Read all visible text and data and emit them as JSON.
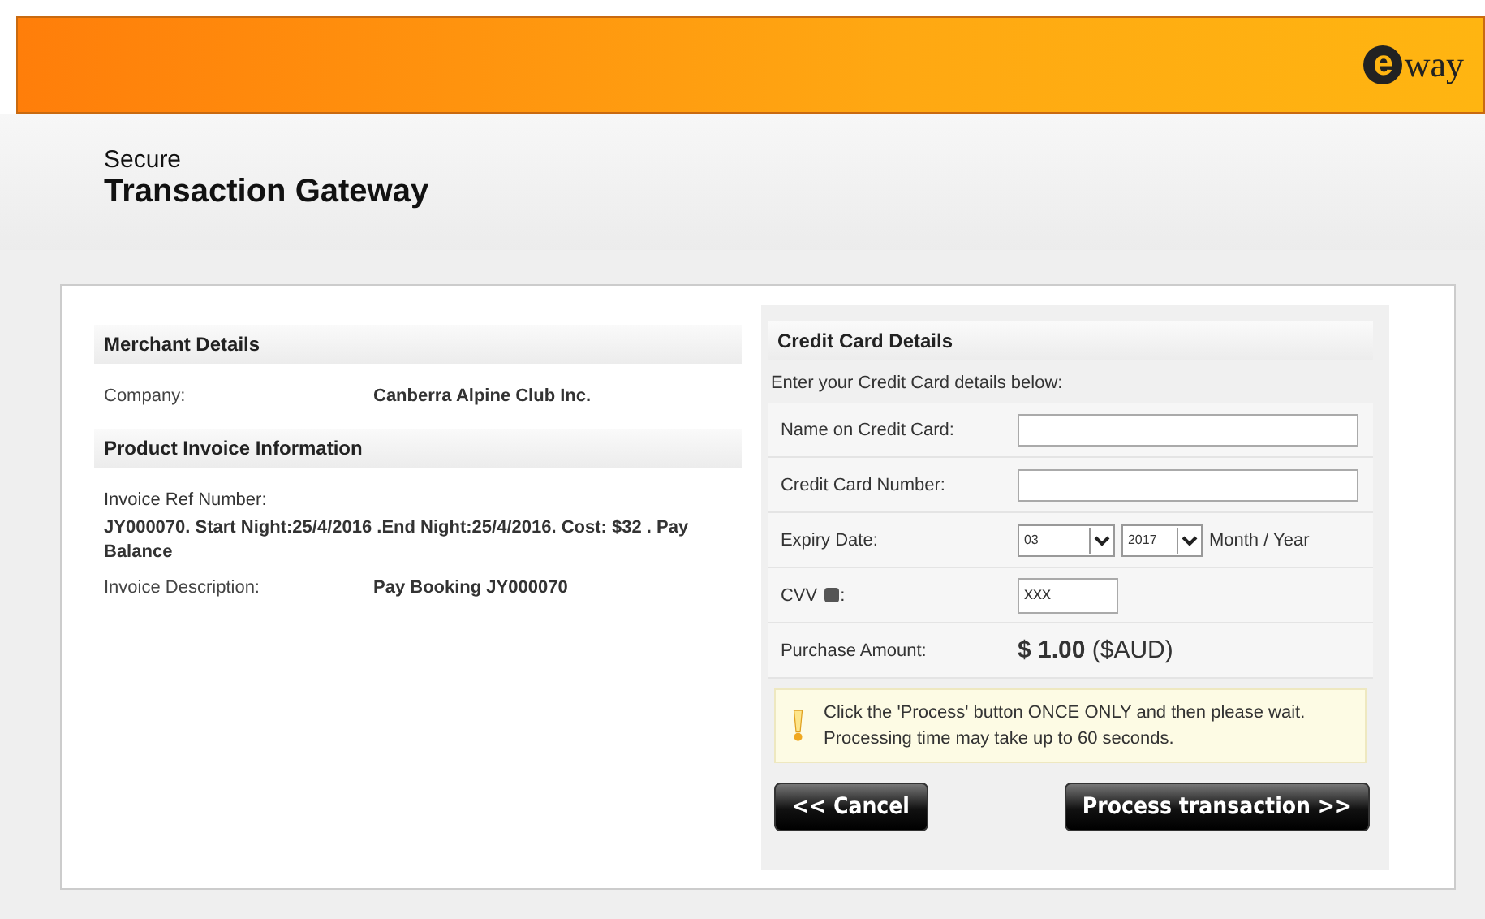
{
  "logo": {
    "mark": "e",
    "text": "way"
  },
  "title": {
    "line1": "Secure",
    "line2": "Transaction Gateway"
  },
  "merchant": {
    "heading": "Merchant Details",
    "rows": [
      {
        "label": "Company:",
        "value": "Canberra Alpine Club Inc."
      }
    ]
  },
  "invoice": {
    "heading": "Product Invoice Information",
    "ref_label": "Invoice Ref Number:",
    "ref_value": "JY000070. Start Night:25/4/2016 .End Night:25/4/2016. Cost: $32 . Pay Balance",
    "rows": [
      {
        "label": "Invoice Description:",
        "value": "Pay Booking JY000070"
      }
    ]
  },
  "card": {
    "heading": "Credit Card Details",
    "intro": "Enter your Credit Card details below:",
    "name_label": "Name on Credit Card:",
    "number_label": "Credit Card Number:",
    "expiry_label": "Expiry Date:",
    "month": "03",
    "year": "2017",
    "expiry_hint": "Month / Year",
    "cvv_label": "CVV",
    "cvv_colon": ":",
    "cvv_value": "xxx",
    "amount_label": "Purchase Amount:",
    "amount": "**$ 1.00** ($AUD)",
    "notice": "Click the 'Process' button ONCE ONLY and then please wait. Processing time may take up to 60 seconds."
  },
  "buttons": {
    "cancel": "<< Cancel",
    "process": "Process transaction >>"
  }
}
